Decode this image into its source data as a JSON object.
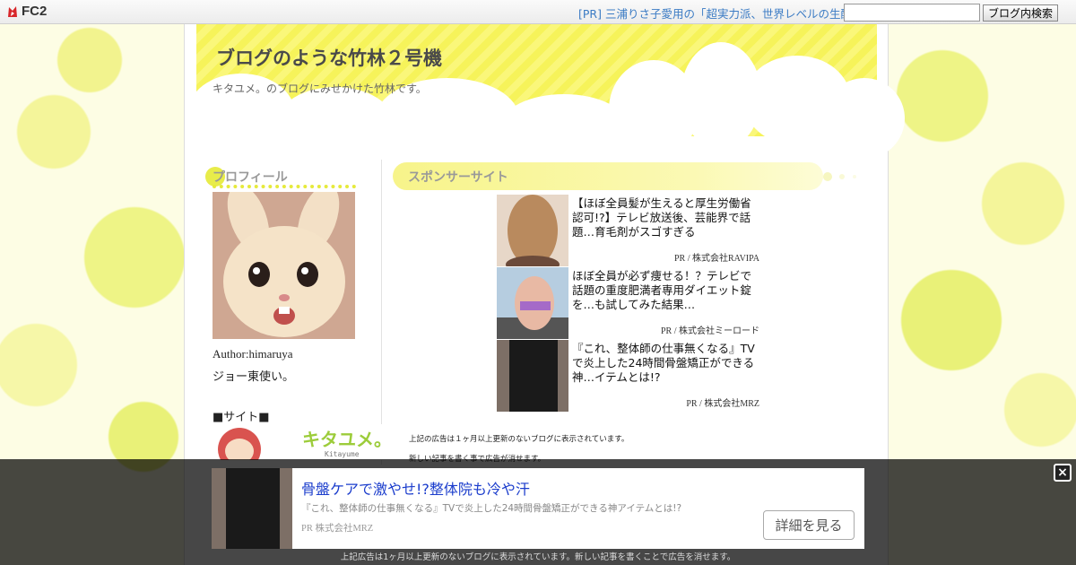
{
  "topbar": {
    "logo_text": "FC2",
    "pr_text": "[PR] 三浦りさ子愛用の「超実力派、世界レベルの生酵",
    "search_placeholder": "",
    "search_button": "ブログ内検索"
  },
  "blog": {
    "title": "ブログのような竹林２号機",
    "description": "キタユメ。のブログにみせかけた竹林です。"
  },
  "sidebar": {
    "profile_heading": "プロフィール",
    "author": "Author:himaruya",
    "bio": "ジョー東使い。",
    "site_heading": "■サイト■",
    "banner_text": "キタユメ。",
    "banner_sub": "Kitayume"
  },
  "main": {
    "heading": "スポンサーサイト",
    "ads": [
      {
        "text": "【ほぼ全員髪が生えると厚生労働省認可!?】テレビ放送後、芸能界で話題…育毛剤がスゴすぎる",
        "source": "PR / 株式会社RAVIPA"
      },
      {
        "text": "ほぼ全員が必ず痩せる！？テレビで話題の重度肥満者専用ダイエット錠を…も試してみた結果…",
        "source": "PR / 株式会社ミーロード"
      },
      {
        "text": "『これ、整体師の仕事無くなる』TVで炎上した24時間骨盤矯正ができる神…イテムとは!?",
        "source": "PR / 株式会社MRZ"
      }
    ],
    "notice1": "上記の広告は１ヶ月以上更新のないブログに表示されています。",
    "notice2": "新しい記事を書く事で広告が消せます。"
  },
  "overlay_ad": {
    "title": "骨盤ケアで激やせ!?整体院も冷や汗",
    "description": "『これ、整体師の仕事無くなる』TVで炎上した24時間骨盤矯正ができる神アイテムとは!?",
    "source": "PR  株式会社MRZ",
    "button": "詳細を見る",
    "close": "×",
    "footer": "上記広告は1ヶ月以上更新のないブログに表示されています。新しい記事を書くことで広告を消せます。"
  },
  "colors": {
    "accent_yellow": "#f6f35a",
    "link_blue": "#3b7bc4",
    "ad_title_blue": "#1a3ccc"
  }
}
